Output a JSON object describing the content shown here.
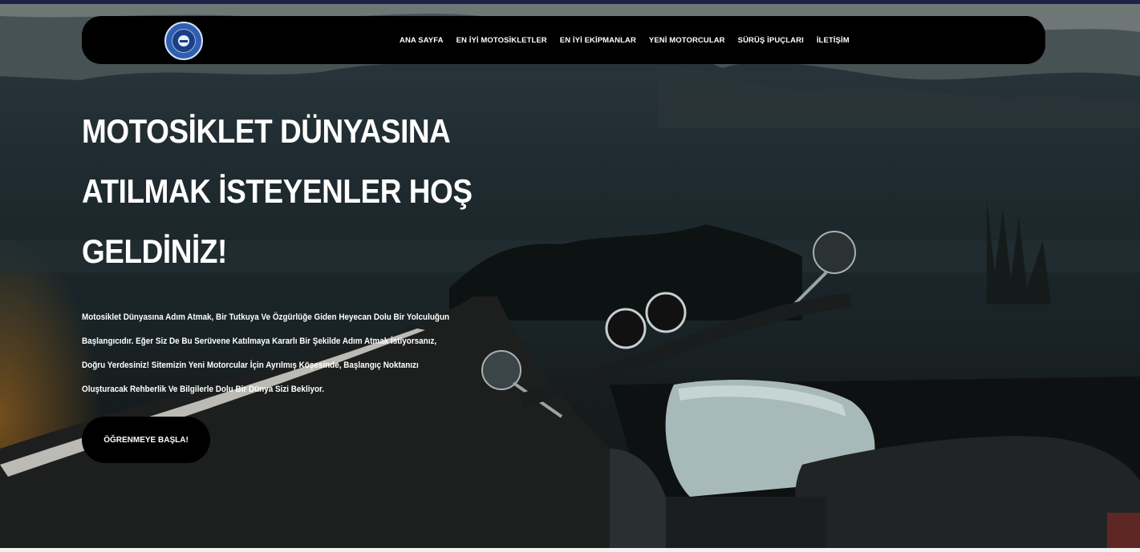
{
  "nav": {
    "logo": {
      "icon": "club-logo-icon",
      "colors": {
        "primary": "#2f5fb0",
        "border": "#d6e2f5"
      }
    },
    "items": [
      {
        "label": "ANA SAYFA"
      },
      {
        "label": "EN İYİ MOTOSİKLETLER"
      },
      {
        "label": "EN İYİ EKİPMANLAR"
      },
      {
        "label": "YENİ MOTORCULAR"
      },
      {
        "label": "SÜRÜŞ İPUÇLARI"
      },
      {
        "label": "İLETİŞİM"
      }
    ]
  },
  "hero": {
    "headline": "MOTOSİKLET DÜNYASINA ATILMAK İSTEYENLER HOŞ GELDİNİZ!",
    "description": "Motosiklet Dünyasına Adım Atmak, Bir Tutkuya Ve Özgürlüğe Giden Heyecan Dolu Bir Yolculuğun Başlangıcıdır. Eğer Siz De Bu Serüvene Katılmaya Kararlı Bir Şekilde Adım Atmak İstiyorsanız, Doğru Yerdesiniz! Sitemizin Yeni Motorcular İçin Ayrılmış Köşesinde, Başlangıç Noktanızı Oluşturacak Rehberlik Ve Bilgilerle Dolu Bir Dünya Sizi Bekliyor.",
    "cta_label": "ÖĞRENMEYE BAŞLA!",
    "background_image": "motorcycle-on-mountain-road-at-dusk"
  },
  "colors": {
    "navbar": "#000000",
    "text": "#ffffff",
    "button": "#000000"
  }
}
